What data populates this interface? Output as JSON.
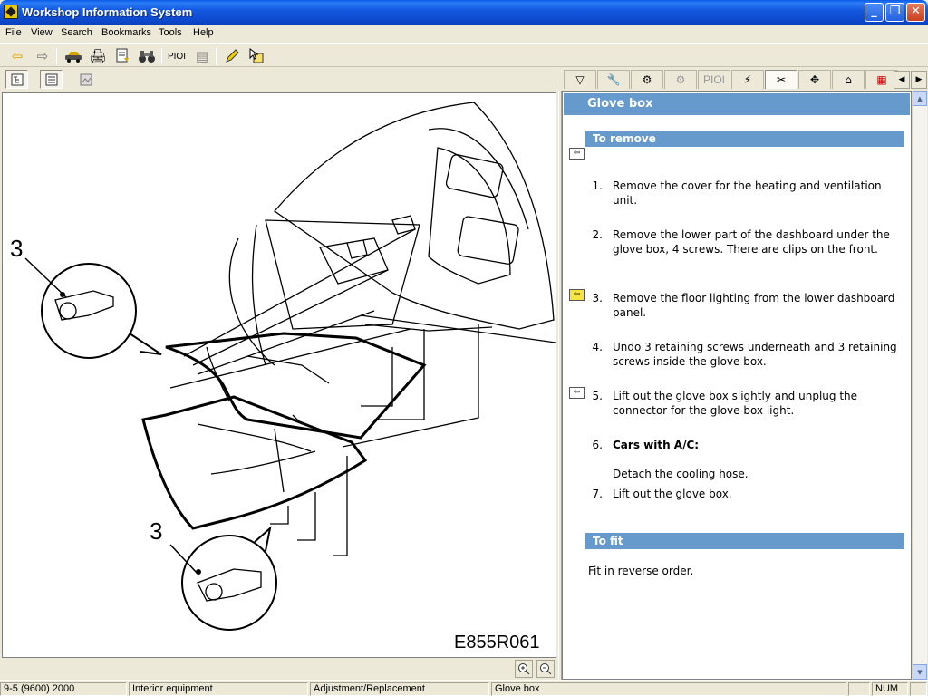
{
  "window": {
    "title": "Workshop Information System"
  },
  "menu": [
    "File",
    "View",
    "Search",
    "Bookmarks",
    "Tools",
    "Help"
  ],
  "toolbar": {
    "pio_label": "PIOI"
  },
  "right_tabs": {
    "pio_label": "PIOI"
  },
  "diagram": {
    "callout_top": "3",
    "callout_bottom": "3",
    "code": "E855R061"
  },
  "document": {
    "title": "Glove box",
    "remove_heading": "To remove",
    "steps": [
      {
        "num": "1.",
        "text": "Remove the cover for the heating and ventilation unit."
      },
      {
        "num": "2.",
        "text": "Remove the lower part of the dashboard under the glove box, 4 screws. There are clips on the front."
      },
      {
        "num": "3.",
        "text": "Remove the floor lighting from the lower dashboard panel."
      },
      {
        "num": "4.",
        "text": "Undo 3 retaining screws underneath and 3 retaining screws inside the glove box."
      },
      {
        "num": "5.",
        "text": "Lift out the glove box slightly and unplug the connector for the glove box light."
      },
      {
        "num": "6.",
        "text": "Cars with A/C:",
        "note": "Detach the cooling hose."
      },
      {
        "num": "7.",
        "text": "Lift out the glove box."
      }
    ],
    "fit_heading": "To fit",
    "fit_text": "Fit in reverse order."
  },
  "statusbar": {
    "model": "9-5 (9600) 2000",
    "group": "Interior equipment",
    "category": "Adjustment/Replacement",
    "topic": "Glove box",
    "numlock": "NUM"
  }
}
